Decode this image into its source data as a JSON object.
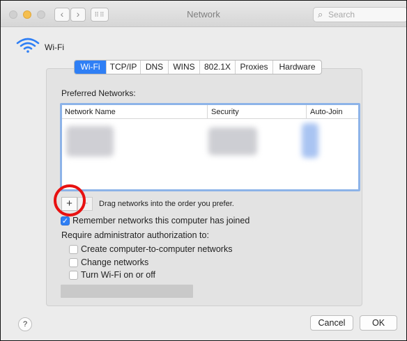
{
  "window": {
    "title": "Network",
    "search_placeholder": "Search",
    "nav_back": "‹",
    "nav_forward": "›",
    "grid_glyph": "⠿⠿",
    "search_glyph": "⌕"
  },
  "header": {
    "interface_name": "Wi-Fi",
    "icon": "wifi-icon",
    "accent_color": "#2f7ff5"
  },
  "tabs": [
    {
      "label": "Wi-Fi",
      "active": true
    },
    {
      "label": "TCP/IP",
      "active": false
    },
    {
      "label": "DNS",
      "active": false
    },
    {
      "label": "WINS",
      "active": false
    },
    {
      "label": "802.1X",
      "active": false
    },
    {
      "label": "Proxies",
      "active": false
    },
    {
      "label": "Hardware",
      "active": false
    }
  ],
  "preferred": {
    "label": "Preferred Networks:",
    "columns": [
      "Network Name",
      "Security",
      "Auto-Join"
    ],
    "add_glyph": "+",
    "remove_glyph": "−",
    "drag_hint": "Drag networks into the order you prefer.",
    "highlight_color": "#e81111"
  },
  "options": {
    "remember": {
      "label": "Remember networks this computer has joined",
      "checked": true,
      "glyph": "✓"
    },
    "require_label": "Require administrator authorization to:",
    "admin_items": [
      {
        "label": "Create computer-to-computer networks",
        "checked": false
      },
      {
        "label": "Change networks",
        "checked": false
      },
      {
        "label": "Turn Wi-Fi on or off",
        "checked": false
      }
    ]
  },
  "footer": {
    "help_glyph": "?",
    "cancel_label": "Cancel",
    "ok_label": "OK"
  }
}
